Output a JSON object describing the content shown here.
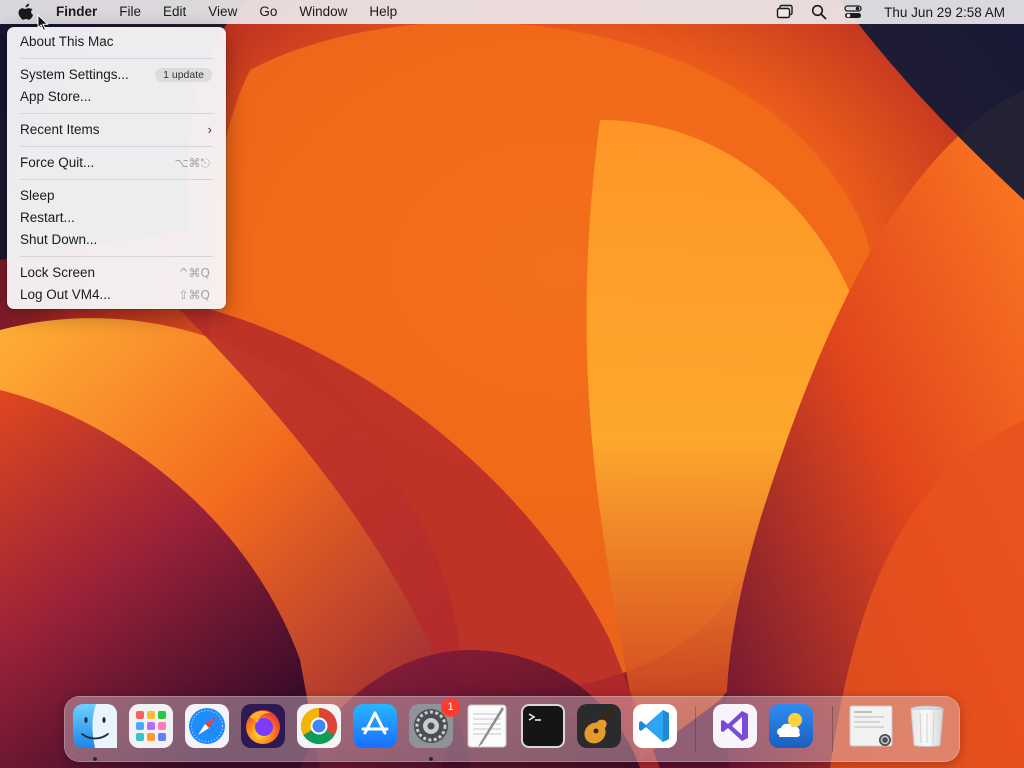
{
  "menubar": {
    "apple_icon": "apple-logo-icon",
    "app_name": "Finder",
    "menus": [
      "File",
      "Edit",
      "View",
      "Go",
      "Window",
      "Help"
    ],
    "status_icons": [
      "screen-mirroring-icon",
      "spotlight-search-icon",
      "control-center-icon"
    ],
    "clock": "Thu Jun 29  2:58 AM"
  },
  "apple_menu": {
    "about": "About This Mac",
    "system_settings": "System Settings...",
    "system_settings_badge": "1 update",
    "app_store": "App Store...",
    "recent_items": "Recent Items",
    "recent_items_arrow": "›",
    "force_quit": "Force Quit...",
    "force_quit_shortcut": "⌥⌘⎋",
    "sleep": "Sleep",
    "restart": "Restart...",
    "shut_down": "Shut Down...",
    "lock_screen": "Lock Screen",
    "lock_screen_shortcut": "^⌘Q",
    "log_out": "Log Out VM4...",
    "log_out_shortcut": "⇧⌘Q"
  },
  "dock": {
    "apps": [
      {
        "icon": "finder-icon",
        "running": true
      },
      {
        "icon": "launchpad-icon",
        "running": false
      },
      {
        "icon": "safari-icon",
        "running": false
      },
      {
        "icon": "firefox-icon",
        "running": false
      },
      {
        "icon": "chrome-icon",
        "running": false
      },
      {
        "icon": "app-store-icon",
        "running": false
      },
      {
        "icon": "system-settings-icon",
        "running": true,
        "badge": "1"
      },
      {
        "icon": "textedit-icon",
        "running": false
      },
      {
        "icon": "terminal-icon",
        "running": false
      },
      {
        "icon": "garageband-icon",
        "running": false
      },
      {
        "icon": "vscode-icon",
        "running": false
      },
      {
        "icon": "visual-studio-icon",
        "running": false
      },
      {
        "icon": "weather-icon",
        "running": false
      },
      {
        "icon": "downloads-stack-icon",
        "running": false
      },
      {
        "icon": "trash-icon",
        "running": false
      }
    ],
    "settings_badge": "1"
  },
  "colors": {
    "wallpaper_orange": "#ff7a12",
    "wallpaper_red": "#d8321c",
    "wallpaper_magenta": "#7a1a4a",
    "wallpaper_navy": "#0c1a33",
    "badge_red": "#ff3b30"
  }
}
